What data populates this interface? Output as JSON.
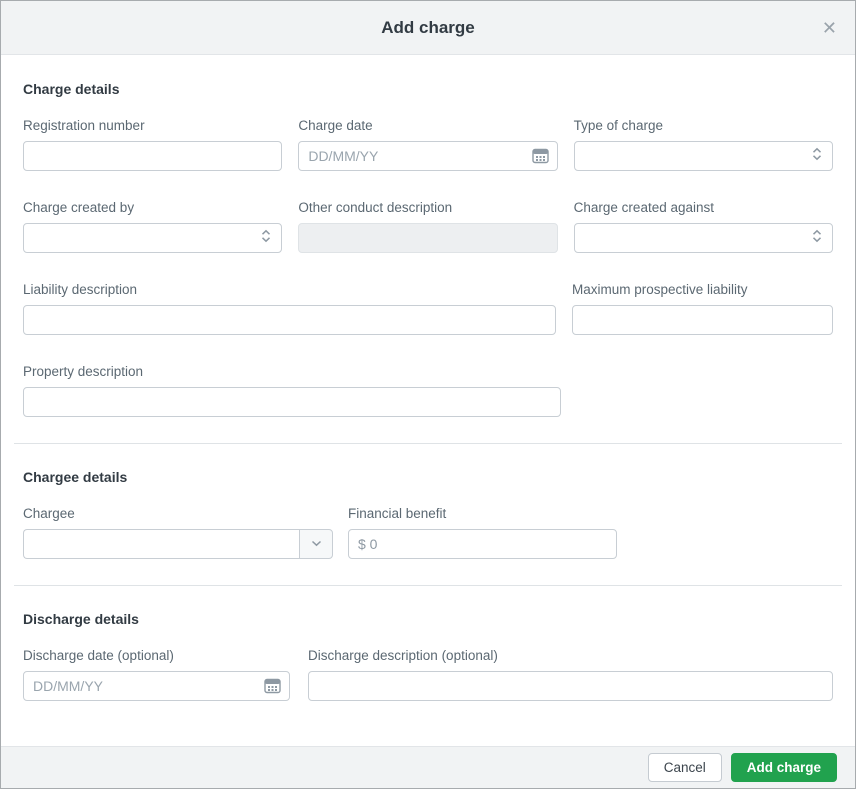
{
  "modal": {
    "title": "Add charge",
    "close_icon": "✕"
  },
  "sections": {
    "charge": {
      "heading": "Charge details",
      "fields": {
        "registration_number": {
          "label": "Registration number",
          "value": ""
        },
        "charge_date": {
          "label": "Charge date",
          "placeholder": "DD/MM/YY",
          "value": ""
        },
        "type_of_charge": {
          "label": "Type of charge",
          "selected_value": ""
        },
        "charge_created_by": {
          "label": "Charge created by",
          "selected_value": ""
        },
        "other_conduct_description": {
          "label": "Other conduct description",
          "value": "",
          "state": "disabled"
        },
        "charge_created_against": {
          "label": "Charge created against",
          "selected_value": ""
        },
        "liability_description": {
          "label": "Liability description",
          "value": ""
        },
        "maximum_prospective_liability": {
          "label": "Maximum prospective liability",
          "value": ""
        },
        "property_description": {
          "label": "Property description",
          "value": ""
        }
      }
    },
    "chargee": {
      "heading": "Chargee details",
      "fields": {
        "chargee": {
          "label": "Chargee",
          "selected_value": ""
        },
        "financial_benefit": {
          "label": "Financial benefit",
          "value": "$ 0"
        }
      }
    },
    "discharge": {
      "heading": "Discharge details",
      "fields": {
        "discharge_date": {
          "label": "Discharge date (optional)",
          "placeholder": "DD/MM/YY",
          "value": ""
        },
        "discharge_description": {
          "label": "Discharge description (optional)",
          "value": ""
        }
      }
    }
  },
  "footer": {
    "cancel_label": "Cancel",
    "submit_label": "Add charge"
  },
  "icons": {
    "calendar": "calendar-icon",
    "select_chevrons": "chevron-up-down-icon",
    "dropdown_chevron": "chevron-down-icon"
  },
  "colors": {
    "accent_green": "#21a24e",
    "header_footer_bg": "#f1f3f4",
    "input_border": "#c8ced4",
    "label_text": "#5b6872",
    "disabled_bg": "#edeff1"
  }
}
